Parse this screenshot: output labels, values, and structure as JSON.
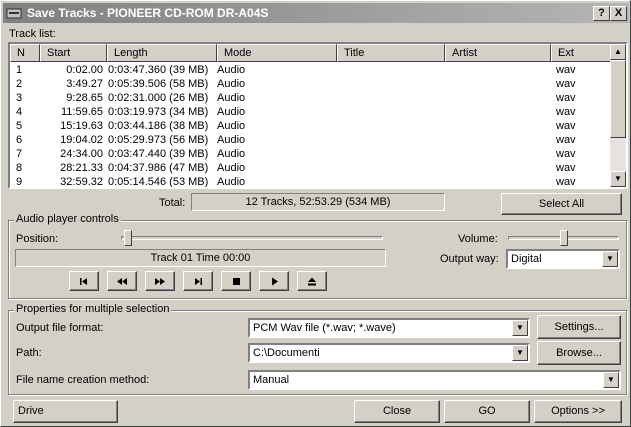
{
  "window": {
    "title": "Save Tracks - PIONEER  CD-ROM DR-A04S",
    "help_label": "?",
    "close_label": "X"
  },
  "tracklist": {
    "label": "Track list:",
    "columns": [
      "N",
      "Start",
      "Length",
      "Mode",
      "Title",
      "Artist",
      "Ext"
    ],
    "rows": [
      {
        "n": "1",
        "start": "0:02.00",
        "length": "0:03:47.360 (39 MB)",
        "mode": "Audio",
        "ext": "wav"
      },
      {
        "n": "2",
        "start": "3:49.27",
        "length": "0:05:39.506 (58 MB)",
        "mode": "Audio",
        "ext": "wav"
      },
      {
        "n": "3",
        "start": "9:28.65",
        "length": "0:02:31.000 (26 MB)",
        "mode": "Audio",
        "ext": "wav"
      },
      {
        "n": "4",
        "start": "11:59.65",
        "length": "0:03:19.973 (34 MB)",
        "mode": "Audio",
        "ext": "wav"
      },
      {
        "n": "5",
        "start": "15:19.63",
        "length": "0:03:44.186 (38 MB)",
        "mode": "Audio",
        "ext": "wav"
      },
      {
        "n": "6",
        "start": "19:04.02",
        "length": "0:05:29.973 (56 MB)",
        "mode": "Audio",
        "ext": "wav"
      },
      {
        "n": "7",
        "start": "24:34.00",
        "length": "0:03:47.440 (39 MB)",
        "mode": "Audio",
        "ext": "wav"
      },
      {
        "n": "8",
        "start": "28:21.33",
        "length": "0:04:37.986 (47 MB)",
        "mode": "Audio",
        "ext": "wav"
      },
      {
        "n": "9",
        "start": "32:59.32",
        "length": "0:05:14.546 (53 MB)",
        "mode": "Audio",
        "ext": "wav"
      }
    ],
    "total_label": "Total:",
    "total_value": "12 Tracks,   52:53.29 (534 MB)",
    "select_all_label": "Select All"
  },
  "player": {
    "group_label": "Audio player controls",
    "position_label": "Position:",
    "status_text": "Track 01 Time 00:00",
    "volume_label": "Volume:",
    "volume_level": 0.5,
    "output_way_label": "Output way:",
    "output_way_value": "Digital",
    "controls": [
      "prev-track-icon",
      "rewind-icon",
      "fast-forward-icon",
      "next-track-icon",
      "stop-icon",
      "play-icon",
      "eject-icon"
    ]
  },
  "properties": {
    "group_label": "Properties for multiple selection",
    "format_label": "Output file format:",
    "format_value": "PCM Wav file (*.wav; *.wave)",
    "settings_label": "Settings...",
    "path_label": "Path:",
    "path_value": "C:\\Documenti",
    "browse_label": "Browse...",
    "naming_label": "File name creation method:",
    "naming_value": "Manual"
  },
  "footer": {
    "drive_label": "Drive",
    "close_label": "Close",
    "go_label": "GO",
    "options_label": "Options >>"
  }
}
